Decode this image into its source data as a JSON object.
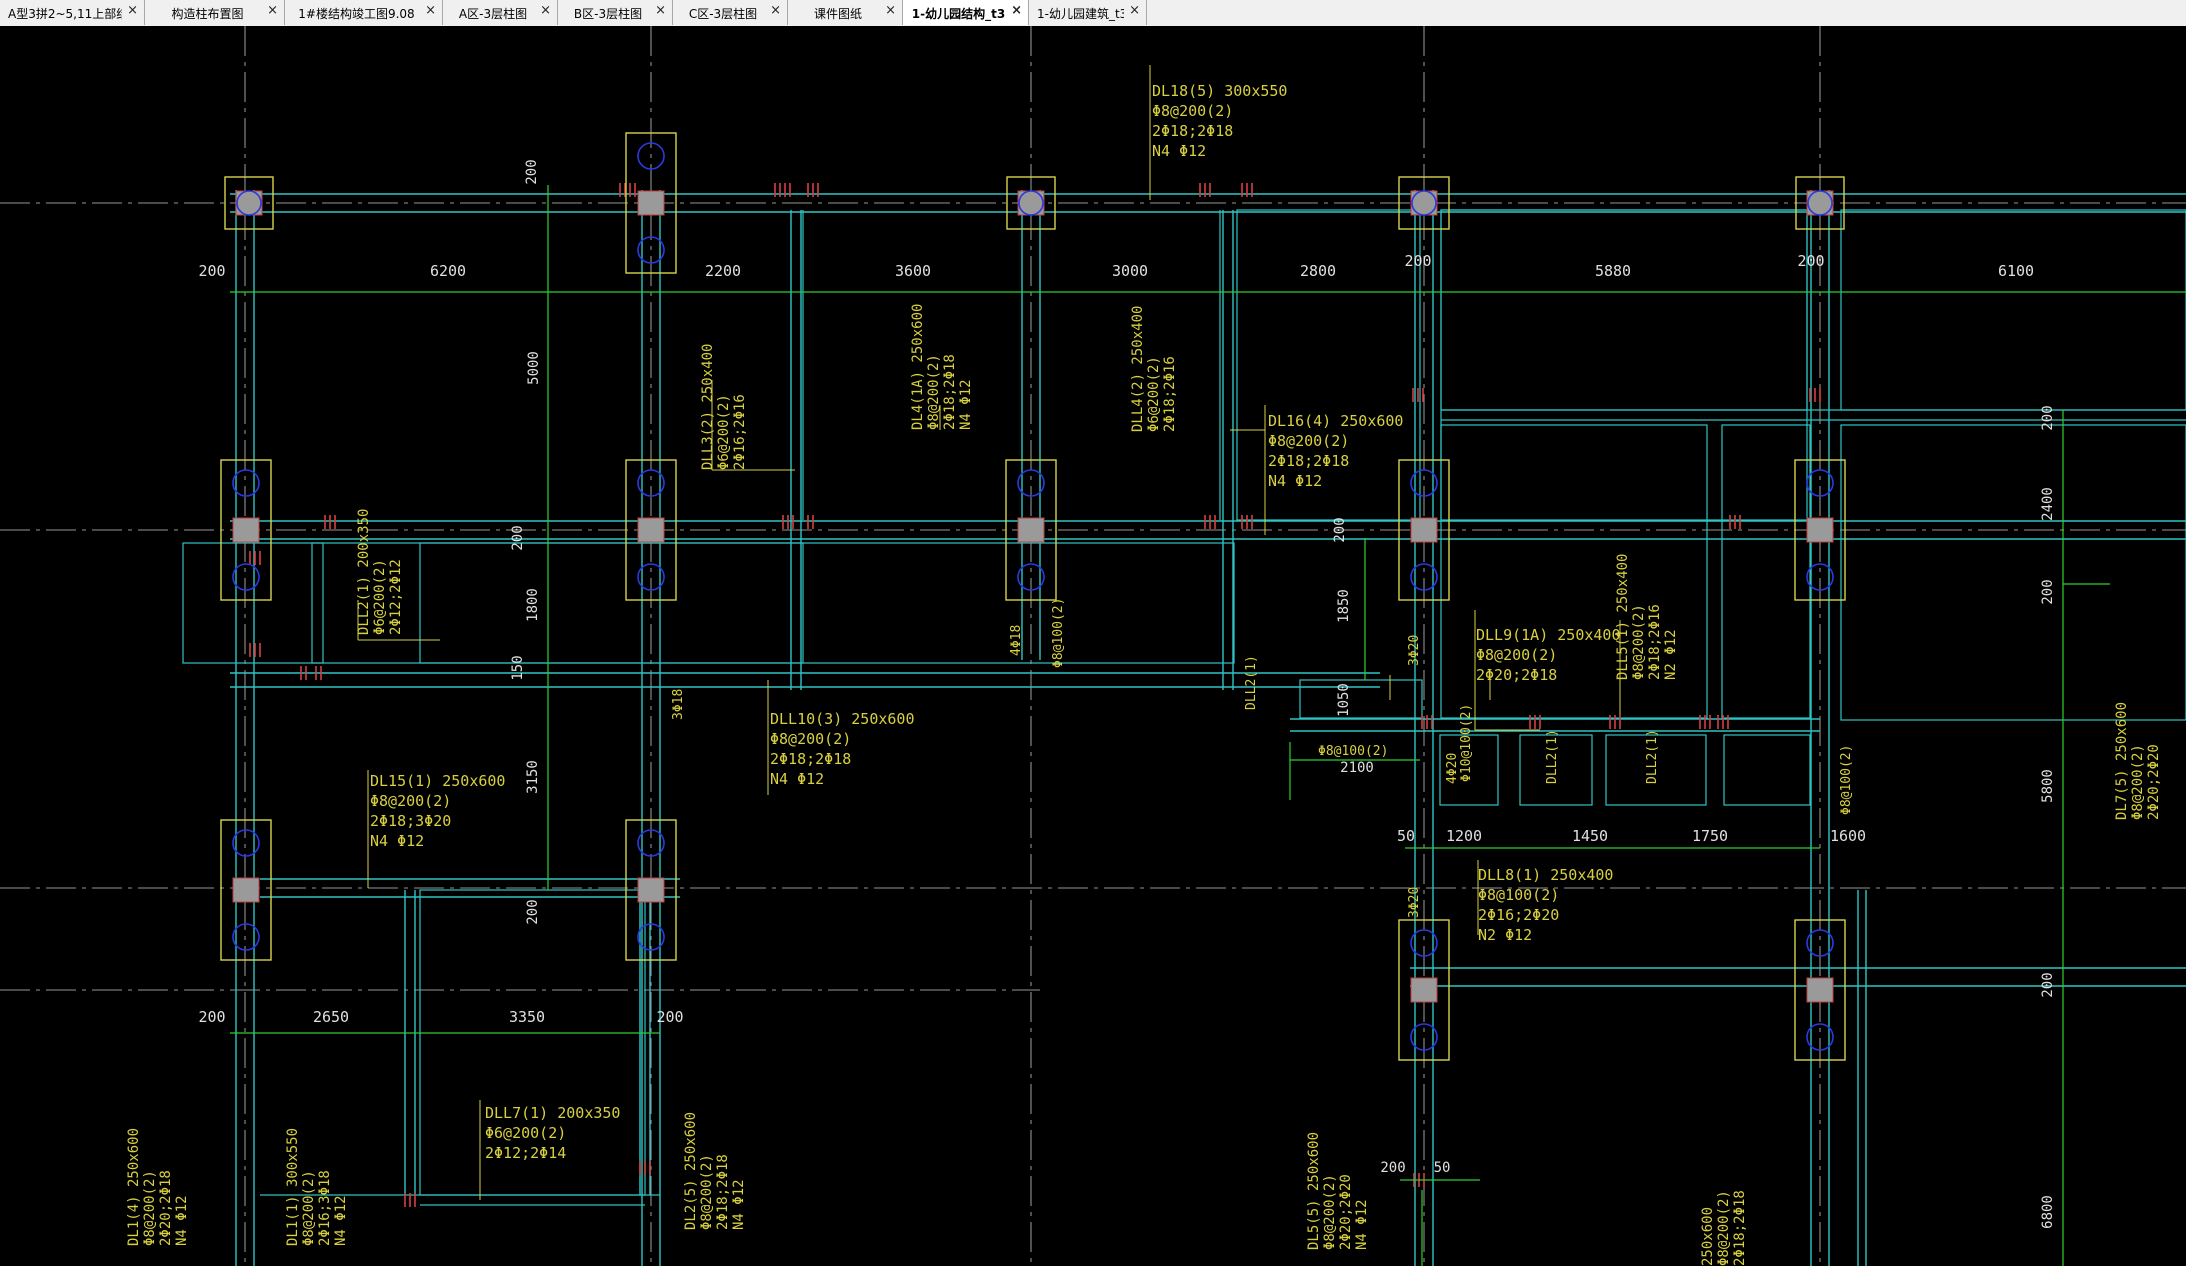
{
  "tabs": [
    {
      "label": "A型3拼2~5,11上部结…",
      "active": false
    },
    {
      "label": "构造柱布置图",
      "active": false
    },
    {
      "label": "1#楼结构竣工图9.08",
      "active": false
    },
    {
      "label": "A区-3层柱图",
      "active": false
    },
    {
      "label": "B区-3层柱图",
      "active": false
    },
    {
      "label": "C区-3层柱图",
      "active": false
    },
    {
      "label": "课件图纸",
      "active": false
    },
    {
      "label": "1-幼儿园结构_t3",
      "active": true
    },
    {
      "label": "1-幼儿园建筑_t3",
      "active": false
    }
  ],
  "tab_close_glyph": "×",
  "colors": {
    "background": "#000000",
    "beam": "#2fc4c4",
    "column_box": "#d7d44b",
    "column_fill": "#9a9a9a",
    "column_circle": "#2a3ae0",
    "dimension": "#2ed02e",
    "annotation": "#d8d040",
    "dim_text": "#e0e0e0",
    "rebar_tick": "#d84040",
    "axis_line": "#c8c8c8"
  },
  "dimensions": {
    "top_row": [
      "200",
      "6200",
      "2200",
      "3600",
      "3000",
      "2800",
      "200",
      "5880",
      "200",
      "6100"
    ],
    "bottom_row": [
      "200",
      "2650",
      "3350",
      "200"
    ],
    "lower_right_row": [
      "50",
      "1200",
      "1450",
      "1750",
      "1600"
    ],
    "left_vertical": [
      "200",
      "5000",
      "200",
      "1800",
      "150",
      "3150",
      "200"
    ],
    "right_vertical": [
      "200",
      "2400",
      "200",
      "5800",
      "200",
      "6800"
    ],
    "misc": [
      "1850",
      "1050",
      "2100",
      "200",
      "50"
    ]
  },
  "beam_labels": [
    {
      "lines": [
        "DL18(5) 300x550",
        "Φ8@200(2)",
        "2Φ18;2Φ18",
        "N4 Φ12"
      ]
    },
    {
      "lines": [
        "DLL3(2) 250x400",
        "Φ6@200(2)",
        "2Φ16;2Φ16"
      ]
    },
    {
      "lines": [
        "DL4(1A) 250x600",
        "Φ8@200(2)",
        "2Φ18;2Φ18",
        "N4 Φ12"
      ]
    },
    {
      "lines": [
        "DLL4(2) 250x400",
        "Φ6@200(2)",
        "2Φ18;2Φ16"
      ]
    },
    {
      "lines": [
        "DL16(4) 250x600",
        "Φ8@200(2)",
        "2Φ18;2Φ18",
        "N4 Φ12"
      ]
    },
    {
      "lines": [
        "DLL2(1) 200x350",
        "Φ6@200(2)",
        "2Φ12;2Φ12"
      ]
    },
    {
      "lines": [
        "DLL10(3) 250x600",
        "Φ8@200(2)",
        "2Φ18;2Φ18",
        "N4 Φ12"
      ]
    },
    {
      "lines": [
        "DLL9(1A) 250x400",
        "Φ8@200(2)",
        "2Φ20;2Φ18"
      ]
    },
    {
      "lines": [
        "DLL5(1) 250x400",
        "Φ8@200(2)",
        "2Φ18;2Φ16",
        "N2 Φ12"
      ]
    },
    {
      "lines": [
        "DL15(1) 250x600",
        "Φ8@200(2)",
        "2Φ18;3Φ20",
        "N4 Φ12"
      ]
    },
    {
      "lines": [
        "DLL8(1) 250x400",
        "Φ8@100(2)",
        "2Φ16;2Φ20",
        "N2 Φ12"
      ]
    },
    {
      "lines": [
        "DLL7(1) 200x350",
        "Φ6@200(2)",
        "2Φ12;2Φ14"
      ]
    },
    {
      "lines": [
        "DL1(4) 250x600",
        "Φ8@200(2)",
        "2Φ20;2Φ18",
        "N4 Φ12"
      ]
    },
    {
      "lines": [
        "DL1(1) 300x550",
        "Φ8@200(2)",
        "2Φ16;3Φ18",
        "N4 Φ12"
      ]
    },
    {
      "lines": [
        "DL2(5) 250x600",
        "Φ8@200(2)",
        "2Φ18;2Φ18",
        "N4 Φ12"
      ]
    },
    {
      "lines": [
        "DL5(5) 250x600",
        "Φ8@200(2)",
        "2Φ20;2Φ20",
        "N4 Φ12"
      ]
    },
    {
      "lines": [
        "DL7(5) 250x600",
        "Φ8@200(2)",
        "2Φ20;2Φ20"
      ]
    },
    {
      "lines": [
        "250x600",
        "Φ8@200(2)",
        "2Φ18;2Φ18"
      ]
    }
  ],
  "small_labels": [
    "4Φ18",
    "Φ8@100(2)",
    "3Φ18",
    "3Φ20",
    "DLL2(1)",
    "DLL2(1)",
    "DLL2(1)",
    "4Φ20",
    "Φ10@100(2)",
    "Φ8@100(2)",
    "Φ8@100(2)",
    "3Φ20"
  ]
}
